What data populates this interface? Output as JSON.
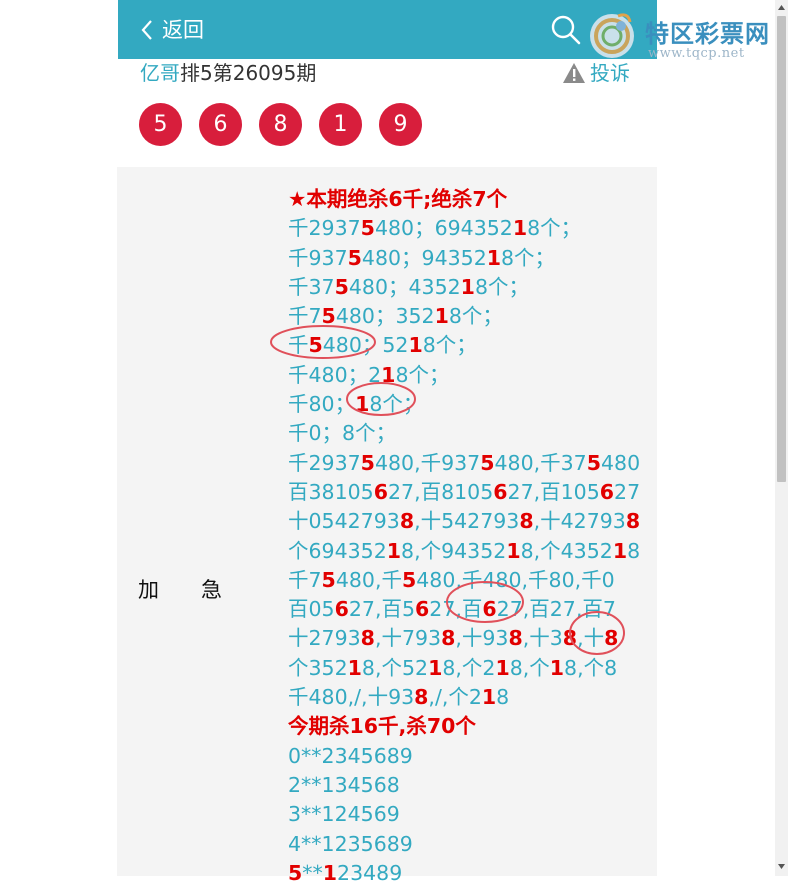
{
  "header": {
    "back_label": "返回",
    "search_icon": "search-icon",
    "back_icon": "chevron-left-icon"
  },
  "watermark": {
    "name": "特区彩票网",
    "url": "www.tqcp.net"
  },
  "subtitle": {
    "author": "亿哥",
    "title": "排5第26095期"
  },
  "complaint": {
    "label": "投诉",
    "icon": "warning-icon"
  },
  "balls": [
    "5",
    "6",
    "8",
    "1",
    "9"
  ],
  "colors": {
    "brand": "#33a9c1",
    "ball": "#d81e3c",
    "highlight": "#e10000",
    "circle": "#e0505a"
  },
  "panel": {
    "label": "加　　急",
    "lines": [
      {
        "style": "hl",
        "parts": [
          [
            "★本期绝杀6千",
            1
          ],
          [
            ";",
            0
          ],
          [
            "绝杀7个",
            1
          ]
        ]
      },
      {
        "parts": [
          [
            "千2937",
            0
          ],
          [
            "5",
            1
          ],
          [
            "480；694352",
            0
          ],
          [
            "1",
            1
          ],
          [
            "8个；",
            0
          ]
        ]
      },
      {
        "parts": [
          [
            "千937",
            0
          ],
          [
            "5",
            1
          ],
          [
            "480；94352",
            0
          ],
          [
            "1",
            1
          ],
          [
            "8个；",
            0
          ]
        ]
      },
      {
        "parts": [
          [
            "千37",
            0
          ],
          [
            "5",
            1
          ],
          [
            "480；4352",
            0
          ],
          [
            "1",
            1
          ],
          [
            "8个；",
            0
          ]
        ]
      },
      {
        "parts": [
          [
            "千7",
            0
          ],
          [
            "5",
            1
          ],
          [
            "480；352",
            0
          ],
          [
            "1",
            1
          ],
          [
            "8个；",
            0
          ]
        ]
      },
      {
        "parts": [
          [
            "千",
            0
          ],
          [
            "5",
            1
          ],
          [
            "480；52",
            0
          ],
          [
            "1",
            1
          ],
          [
            "8个；",
            0
          ]
        ]
      },
      {
        "parts": [
          [
            "千480；2",
            0
          ],
          [
            "1",
            1
          ],
          [
            "8个；",
            0
          ]
        ]
      },
      {
        "parts": [
          [
            "千80；",
            0
          ],
          [
            "1",
            1
          ],
          [
            "8个；",
            0
          ]
        ]
      },
      {
        "parts": [
          [
            "千0；8个；",
            0
          ]
        ]
      },
      {
        "parts": [
          [
            "千2937",
            0
          ],
          [
            "5",
            1
          ],
          [
            "480,千937",
            0
          ],
          [
            "5",
            1
          ],
          [
            "480,千37",
            0
          ],
          [
            "5",
            1
          ],
          [
            "480",
            0
          ]
        ]
      },
      {
        "parts": [
          [
            "百38105",
            0
          ],
          [
            "6",
            1
          ],
          [
            "27,百8105",
            0
          ],
          [
            "6",
            1
          ],
          [
            "27,百105",
            0
          ],
          [
            "6",
            1
          ],
          [
            "27",
            0
          ]
        ]
      },
      {
        "parts": [
          [
            "十0542793",
            0
          ],
          [
            "8",
            1
          ],
          [
            ",十542793",
            0
          ],
          [
            "8",
            1
          ],
          [
            ",十42793",
            0
          ],
          [
            "8",
            1
          ]
        ]
      },
      {
        "parts": [
          [
            "个694352",
            0
          ],
          [
            "1",
            1
          ],
          [
            "8,个94352",
            0
          ],
          [
            "1",
            1
          ],
          [
            "8,个4352",
            0
          ],
          [
            "1",
            1
          ],
          [
            "8",
            0
          ]
        ]
      },
      {
        "parts": [
          [
            "千7",
            0
          ],
          [
            "5",
            1
          ],
          [
            "480,千",
            0
          ],
          [
            "5",
            1
          ],
          [
            "480,千480,千80,千0",
            0
          ]
        ]
      },
      {
        "parts": [
          [
            "百05",
            0
          ],
          [
            "6",
            1
          ],
          [
            "27,百5",
            0
          ],
          [
            "6",
            1
          ],
          [
            "27,百",
            0
          ],
          [
            "6",
            1
          ],
          [
            "27,百27,百7",
            0
          ]
        ]
      },
      {
        "parts": [
          [
            "十2793",
            0
          ],
          [
            "8",
            1
          ],
          [
            ",十793",
            0
          ],
          [
            "8",
            1
          ],
          [
            ",十93",
            0
          ],
          [
            "8",
            1
          ],
          [
            ",十3",
            0
          ],
          [
            "8",
            1
          ],
          [
            ",十",
            0
          ],
          [
            "8",
            1
          ]
        ]
      },
      {
        "parts": [
          [
            "个352",
            0
          ],
          [
            "1",
            1
          ],
          [
            "8,个52",
            0
          ],
          [
            "1",
            1
          ],
          [
            "8,个2",
            0
          ],
          [
            "1",
            1
          ],
          [
            "8,个",
            0
          ],
          [
            "1",
            1
          ],
          [
            "8,个8",
            0
          ]
        ]
      },
      {
        "parts": [
          [
            "千480,/,十93",
            0
          ],
          [
            "8",
            1
          ],
          [
            ",/,个2",
            0
          ],
          [
            "1",
            1
          ],
          [
            "8",
            0
          ]
        ]
      },
      {
        "style": "hl",
        "parts": [
          [
            "今期杀16千",
            1
          ],
          [
            ",",
            0
          ],
          [
            "杀70个",
            1
          ]
        ]
      },
      {
        "parts": [
          [
            "0**2345689",
            0
          ]
        ]
      },
      {
        "parts": [
          [
            "2**134568",
            0
          ]
        ]
      },
      {
        "parts": [
          [
            "3**124569",
            0
          ]
        ]
      },
      {
        "parts": [
          [
            "4**1235689",
            0
          ]
        ]
      },
      {
        "parts": [
          [
            "5",
            1
          ],
          [
            "**",
            0
          ],
          [
            "1",
            1
          ],
          [
            "23489",
            0
          ]
        ]
      }
    ]
  }
}
